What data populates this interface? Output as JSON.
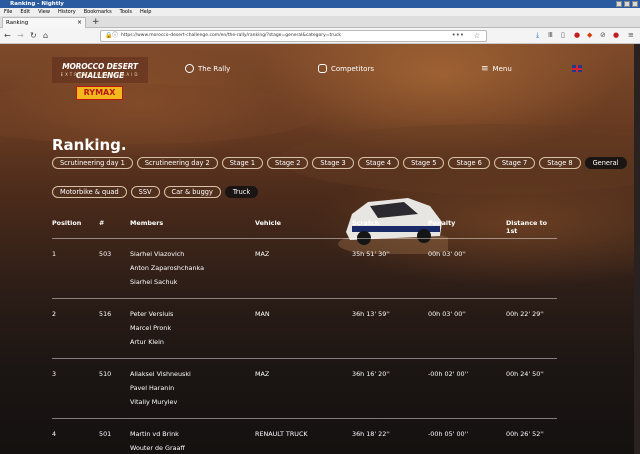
{
  "window": {
    "title": "Ranking - Nightly",
    "menu": [
      "File",
      "Edit",
      "View",
      "History",
      "Bookmarks",
      "Tools",
      "Help"
    ],
    "tab_label": "Ranking",
    "url": "https://www.morocco-desert-challenge.com/en/the-rally/ranking/?stage=general&category=truck"
  },
  "header": {
    "logo_line1": "MOROCCO DESERT CHALLENGE",
    "logo_line2": "EXTREME RALLY RAID",
    "logo_brand": "RYMAX",
    "nav": [
      {
        "label": "The Rally",
        "icon": "steering-wheel-icon"
      },
      {
        "label": "Competitors",
        "icon": "competitors-icon"
      },
      {
        "label": "Menu",
        "icon": "hamburger-icon"
      }
    ],
    "language_flag": "uk-flag-icon"
  },
  "page": {
    "title": "Ranking.",
    "stage_tabs": [
      "Scrutineering day 1",
      "Scrutineering day 2",
      "Stage 1",
      "Stage 2",
      "Stage 3",
      "Stage 4",
      "Stage 5",
      "Stage 6",
      "Stage 7",
      "Stage 8",
      "General"
    ],
    "active_stage": "General",
    "category_tabs": [
      "Motorbike & quad",
      "SSV",
      "Car & buggy",
      "Truck"
    ],
    "active_category": "Truck"
  },
  "table": {
    "headers": [
      "Position",
      "#",
      "Members",
      "Vehicle",
      "Scratch",
      "Penalty",
      "Distance to 1st"
    ],
    "rows": [
      {
        "position": "1",
        "number": "503",
        "members": [
          "Siarhei Viazovich",
          "Anton Zaparoshchanka",
          "Siarhei Sachuk"
        ],
        "vehicle": "MAZ",
        "scratch": "35h 51' 30''",
        "penalty": "00h 03' 00''",
        "distance": ""
      },
      {
        "position": "2",
        "number": "516",
        "members": [
          "Peter Versluis",
          "Marcel Pronk",
          "Artur Klein"
        ],
        "vehicle": "MAN",
        "scratch": "36h 13' 59''",
        "penalty": "00h 03' 00''",
        "distance": "00h 22' 29''"
      },
      {
        "position": "3",
        "number": "510",
        "members": [
          "Aliaksei Vishneuski",
          "Pavel Haranin",
          "Vitaliy Murylev"
        ],
        "vehicle": "MAZ",
        "scratch": "36h 16' 20''",
        "penalty": "-00h 02' 00''",
        "distance": "00h 24' 50''"
      },
      {
        "position": "4",
        "number": "501",
        "members": [
          "Martin vd Brink",
          "Wouter de Graaff"
        ],
        "vehicle": "RENAULT TRUCK",
        "scratch": "36h 18' 22''",
        "penalty": "-00h 05' 00''",
        "distance": "00h 26' 52''"
      }
    ]
  }
}
